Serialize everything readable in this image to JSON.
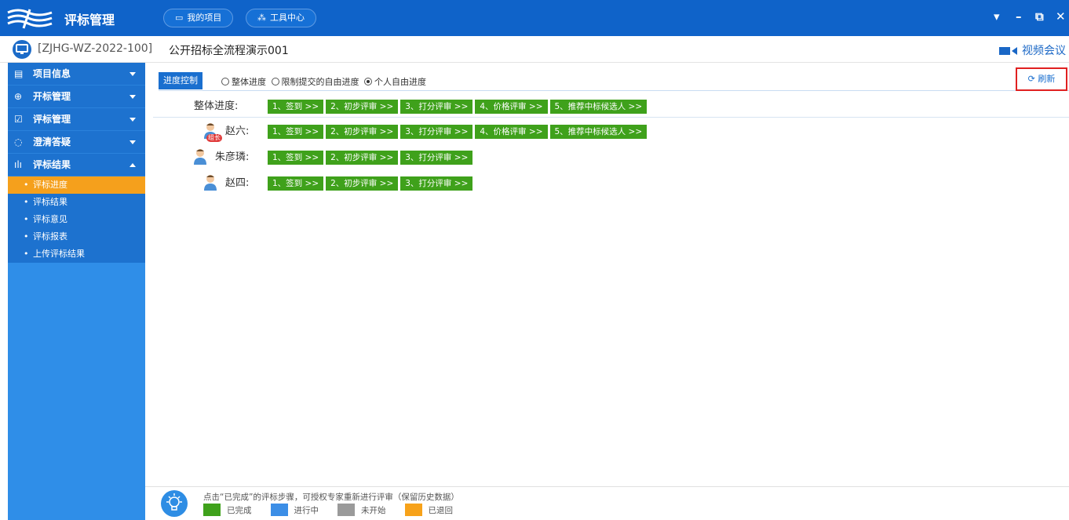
{
  "app": {
    "title": "评标管理",
    "nav": [
      {
        "label": "我的项目",
        "icon": "monitor-icon"
      },
      {
        "label": "工具中心",
        "icon": "tools-icon"
      }
    ],
    "window_controls": [
      "menu-icon",
      "minimize-icon",
      "restore-icon",
      "close-icon"
    ]
  },
  "project": {
    "code": "[ZJHG-WZ-2022-100]",
    "name": "公开招标全流程演示001",
    "video_label": "视频会议"
  },
  "sidebar": {
    "items": [
      {
        "label": "项目信息",
        "icon": "project-info-icon",
        "expanded": false
      },
      {
        "label": "开标管理",
        "icon": "bid-opening-icon",
        "expanded": false
      },
      {
        "label": "评标管理",
        "icon": "evaluation-icon",
        "expanded": false
      },
      {
        "label": "澄清答疑",
        "icon": "chat-icon",
        "expanded": false
      },
      {
        "label": "评标结果",
        "icon": "bar-chart-icon",
        "expanded": true
      }
    ],
    "subitems": [
      {
        "label": "评标进度",
        "active": true
      },
      {
        "label": "评标结果",
        "active": false
      },
      {
        "label": "评标意见",
        "active": false
      },
      {
        "label": "评标报表",
        "active": false
      },
      {
        "label": "上传评标结果",
        "active": false
      }
    ]
  },
  "toolbar": {
    "label": "进度控制",
    "options": [
      {
        "label": "整体进度",
        "checked": false
      },
      {
        "label": "限制提交的自由进度",
        "checked": false
      },
      {
        "label": "个人自由进度",
        "checked": true
      }
    ],
    "refresh_label": "刷新"
  },
  "progress": {
    "overall": {
      "label": "整体进度:",
      "steps": [
        "1、签到 >>",
        "2、初步评审 >>",
        "3、打分评审 >>",
        "4、价格评审 >>",
        "5、推荐中标候选人 >>"
      ]
    },
    "experts": [
      {
        "name": "赵六:",
        "badge": "组长",
        "steps": [
          "1、签到 >>",
          "2、初步评审 >>",
          "3、打分评审 >>",
          "4、价格评审 >>",
          "5、推荐中标候选人 >>"
        ]
      },
      {
        "name": "朱彦璘:",
        "badge": "",
        "steps": [
          "1、签到 >>",
          "2、初步评审 >>",
          "3、打分评审 >>"
        ]
      },
      {
        "name": "赵四:",
        "badge": "",
        "steps": [
          "1、签到 >>",
          "2、初步评审 >>",
          "3、打分评审 >>"
        ]
      }
    ]
  },
  "footer": {
    "hint": "点击“已完成”的评标步骤，可授权专家重新进行评审（保留历史数据）",
    "legend": [
      {
        "label": "已完成",
        "color": "#3fa11b"
      },
      {
        "label": "进行中",
        "color": "#3c8ee6"
      },
      {
        "label": "未开始",
        "color": "#9a9a9a"
      },
      {
        "label": "已退回",
        "color": "#f7a21a"
      }
    ]
  }
}
